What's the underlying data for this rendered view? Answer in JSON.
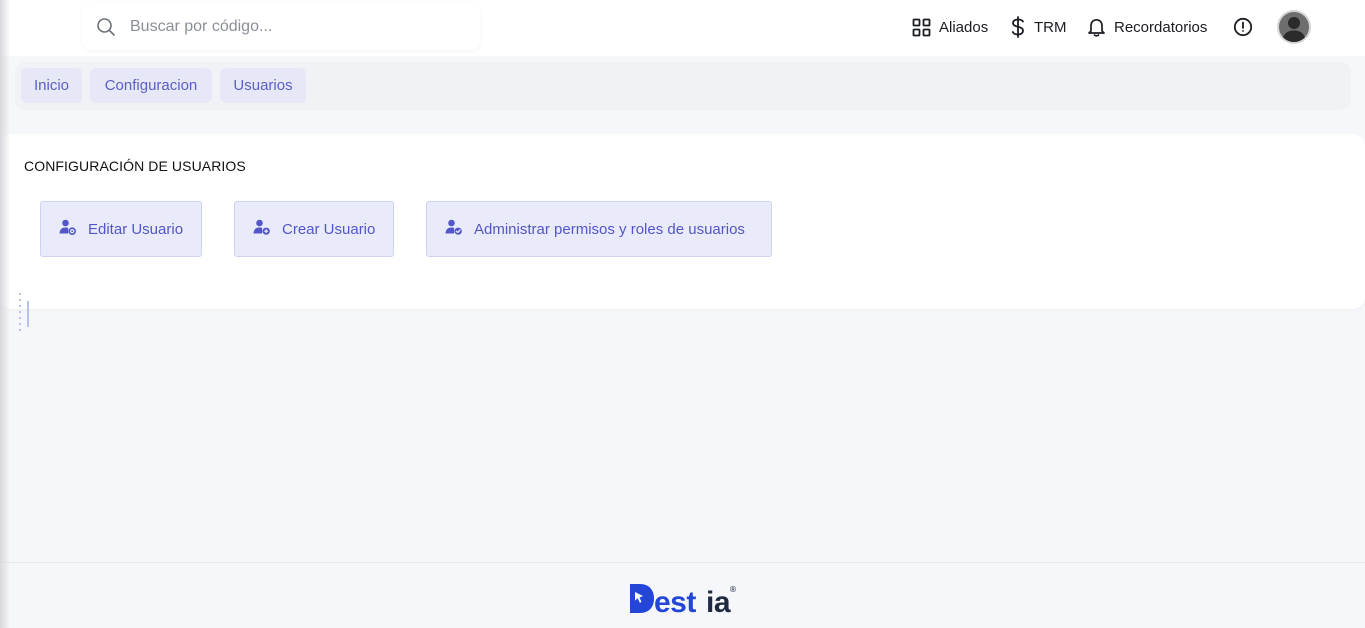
{
  "search": {
    "placeholder": "Buscar por código...",
    "value": ""
  },
  "topnav": {
    "aliados": "Aliados",
    "trm": "TRM",
    "recordatorios": "Recordatorios"
  },
  "breadcrumb": [
    "Inicio",
    "Configuracion",
    "Usuarios"
  ],
  "section_title": "CONFIGURACIÓN DE USUARIOS",
  "actions": [
    {
      "label": "Editar Usuario",
      "icon": "user-gear-icon"
    },
    {
      "label": "Crear Usuario",
      "icon": "user-plus-icon"
    },
    {
      "label": "Administrar permisos y roles de usuarios",
      "icon": "user-check-icon"
    }
  ],
  "footer": {
    "logo_text": "Destia",
    "logo_mark": "®"
  },
  "colors": {
    "accent": "#5356c9",
    "button_bg": "#e9ebfa",
    "logo_blue": "#2446d8",
    "logo_dark": "#1e2a44"
  }
}
